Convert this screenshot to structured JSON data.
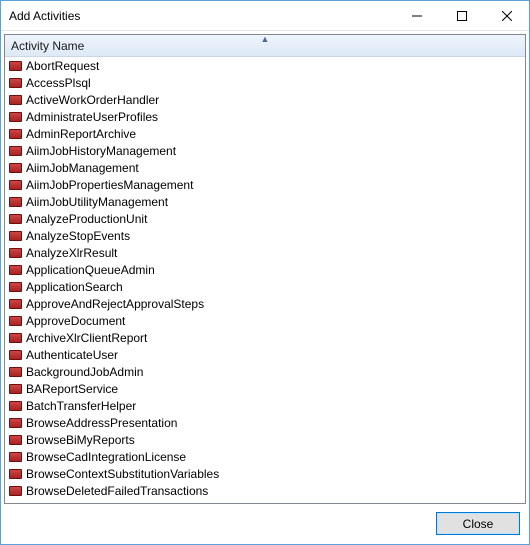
{
  "window": {
    "title": "Add Activities"
  },
  "list": {
    "column_header": "Activity Name",
    "items": [
      "AbortRequest",
      "AccessPlsql",
      "ActiveWorkOrderHandler",
      "AdministrateUserProfiles",
      "AdminReportArchive",
      "AiimJobHistoryManagement",
      "AiimJobManagement",
      "AiimJobPropertiesManagement",
      "AiimJobUtilityManagement",
      "AnalyzeProductionUnit",
      "AnalyzeStopEvents",
      "AnalyzeXlrResult",
      "ApplicationQueueAdmin",
      "ApplicationSearch",
      "ApproveAndRejectApprovalSteps",
      "ApproveDocument",
      "ArchiveXlrClientReport",
      "AuthenticateUser",
      "BackgroundJobAdmin",
      "BAReportService",
      "BatchTransferHelper",
      "BrowseAddressPresentation",
      "BrowseBiMyReports",
      "BrowseCadIntegrationLicense",
      "BrowseContextSubstitutionVariables",
      "BrowseDeletedFailedTransactions"
    ]
  },
  "buttons": {
    "close": "Close"
  }
}
